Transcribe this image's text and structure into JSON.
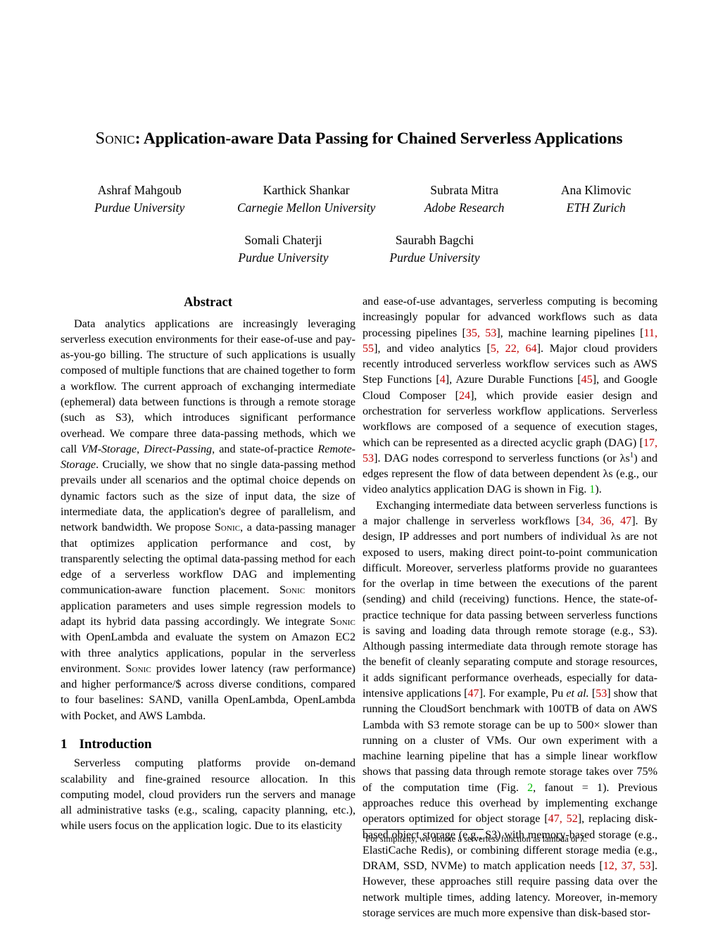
{
  "paper": {
    "title_smallcaps": "Sonic",
    "title_rest": ": Application-aware Data Passing for Chained Serverless Applications",
    "authors": [
      [
        {
          "name": "Ashraf Mahgoub",
          "affiliation": "Purdue University"
        },
        {
          "name": "Karthick Shankar",
          "affiliation": "Carnegie Mellon University"
        },
        {
          "name": "Subrata Mitra",
          "affiliation": "Adobe Research"
        },
        {
          "name": "Ana Klimovic",
          "affiliation": "ETH Zurich"
        }
      ],
      [
        {
          "name": "Somali Chaterji",
          "affiliation": "Purdue University"
        },
        {
          "name": "Saurabh Bagchi",
          "affiliation": "Purdue University"
        }
      ]
    ],
    "abstract": {
      "heading": "Abstract",
      "text_part_1": "Data analytics applications are increasingly leveraging serverless execution environments for their ease-of-use and pay-as-you-go billing. The structure of such applications is usually composed of multiple functions that are chained together to form a workflow. The current approach of exchanging intermediate (ephemeral) data between functions is through a remote storage (such as S3), which introduces significant performance overhead. We compare three data-passing methods, which we call ",
      "em_1": "VM-Storage",
      "text_part_2": ", ",
      "em_2": "Direct-Passing",
      "text_part_3": ", and state-of-practice ",
      "em_3": "Remote-Storage",
      "text_part_4": ". Crucially, we show that no single data-passing method prevails under all scenarios and the optimal choice depends on dynamic factors such as the size of input data, the size of intermediate data, the application's degree of parallelism, and network bandwidth. We propose ",
      "sc_1": "Sonic",
      "text_part_5": ", a data-passing manager that optimizes application performance and cost, by transparently selecting the optimal data-passing method for each edge of a serverless workflow DAG and implementing communication-aware function placement. ",
      "sc_2": "Sonic",
      "text_part_6": " monitors application parameters and uses simple regression models to adapt its hybrid data passing accordingly. We integrate ",
      "sc_3": "Sonic",
      "text_part_7": " with OpenLambda and evaluate the system on Amazon EC2 with three analytics applications, popular in the serverless environment. ",
      "sc_4": "Sonic",
      "text_part_8": " provides lower latency (raw performance) and higher performance/$ across diverse conditions, compared to four baselines: SAND, vanilla OpenLambda, OpenLambda with Pocket, and AWS Lambda."
    },
    "introduction": {
      "number": "1",
      "heading": "Introduction",
      "p1_a": "Serverless computing platforms provide on-demand scalability and fine-grained resource allocation. In this computing model, cloud providers run the servers and manage all administrative tasks (e.g., scaling, capacity planning, etc.), while users focus on the application logic. Due to its elasticity and ease-of-use advantages, serverless computing is becoming increasingly popular for advanced workflows such as data processing pipelines [",
      "cite_1": "35, 53",
      "p1_b": "], machine learning pipelines [",
      "cite_2": "11, 55",
      "p1_c": "], and video analytics [",
      "cite_3": "5, 22, 64",
      "p1_d": "]. Major cloud providers recently introduced serverless workflow services such as AWS Step Functions [",
      "cite_4": "4",
      "p1_e": "], Azure Durable Functions [",
      "cite_5": "45",
      "p1_f": "], and Google Cloud Composer [",
      "cite_6": "24",
      "p1_g": "], which provide easier design and orchestration for serverless workflow applications. Serverless workflows are composed of a sequence of execution stages, which can be represented as a directed acyclic graph (DAG) [",
      "cite_7": "17, 53",
      "p1_h": "]. DAG nodes correspond to serverless functions (or λs",
      "fn_marker": "1",
      "p1_i": ") and edges represent the flow of data between dependent λs (e.g., our video analytics application DAG is shown in Fig. ",
      "figref_1": "1",
      "p1_j": ").",
      "p2_a": "Exchanging intermediate data between serverless functions is a major challenge in serverless workflows [",
      "cite_8": "34, 36, 47",
      "p2_b": "]. By design, IP addresses and port numbers of individual λs are not exposed to users, making direct point-to-point communication difficult. Moreover, serverless platforms provide no guarantees for the overlap in time between the executions of the parent (sending) and child (receiving) functions. Hence, the state-of-practice technique for data passing between serverless functions is saving and loading data through remote storage (e.g., S3). Although passing intermediate data through remote storage has the benefit of cleanly separating compute and storage resources, it adds significant performance overheads, especially for data-intensive applications [",
      "cite_9": "47",
      "p2_c": "]. For example, Pu ",
      "em_etal": "et al.",
      "p2_d": " [",
      "cite_10": "53",
      "p2_e": "] show that running the CloudSort benchmark with 100TB of data on AWS Lambda with S3 remote storage can be up to 500× slower than running on a cluster of VMs. Our own experiment with a machine learning pipeline that has a simple linear workflow shows that passing data through remote storage takes over 75% of the computation time (Fig. ",
      "figref_2": "2",
      "p2_f": ", fanout = 1). Previous approaches reduce this overhead by implementing exchange operators optimized for object storage [",
      "cite_11": "47, 52",
      "p2_g": "], replacing disk-based object storage (e.g., S3) with memory-based storage (e.g., ElastiCache Redis), or combining different storage media (e.g., DRAM, SSD, NVMe) to match application needs [",
      "cite_12": "12, 37, 53",
      "p2_h": "]. However, these approaches still require passing data over the network multiple times, adding latency. Moreover, in-memory storage services are much more expensive than disk-based stor-"
    },
    "footnote": {
      "marker": "1",
      "text": "For simplicity, we denote a serverless function as lambda or λ."
    }
  },
  "colors": {
    "citation": "#c00000",
    "figure_reference": "#00bb00",
    "text": "#000000",
    "background": "#ffffff"
  }
}
